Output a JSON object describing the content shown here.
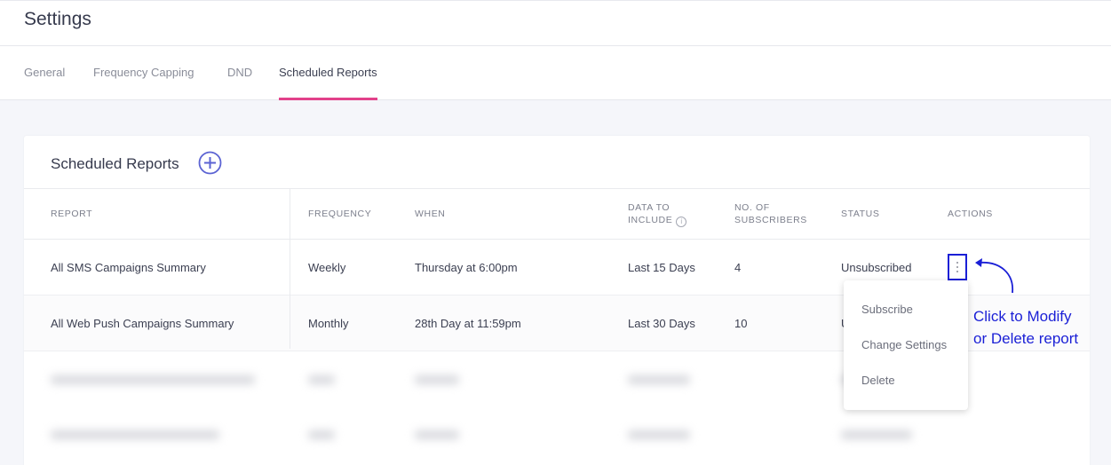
{
  "header": {
    "title": "Settings"
  },
  "tabs": [
    {
      "label": "General",
      "active": false
    },
    {
      "label": "Frequency Capping",
      "active": false
    },
    {
      "label": "DND",
      "active": false
    },
    {
      "label": "Scheduled Reports",
      "active": true
    }
  ],
  "card": {
    "title": "Scheduled Reports",
    "add_icon": "plus-circle-icon",
    "columns": {
      "report": "REPORT",
      "frequency": "FREQUENCY",
      "when": "WHEN",
      "data_line1": "DATA TO",
      "data_line2": "INCLUDE",
      "subs_line1": "NO. OF",
      "subs_line2": "SUBSCRIBERS",
      "status": "STATUS",
      "actions": "ACTIONS"
    },
    "rows": [
      {
        "report": "All SMS Campaigns Summary",
        "frequency": "Weekly",
        "when": "Thursday at 6:00pm",
        "data": "Last 15 Days",
        "subscribers": "4",
        "status": "Unsubscribed"
      },
      {
        "report": "All Web Push Campaigns Summary",
        "frequency": "Monthly",
        "when": "28th Day at 11:59pm",
        "data": "Last 30 Days",
        "subscribers": "10",
        "status": "U"
      }
    ]
  },
  "menu": {
    "items": [
      "Subscribe",
      "Change Settings",
      "Delete"
    ]
  },
  "annotation": {
    "line1": "Click to Modify",
    "line2": "or Delete report"
  },
  "colors": {
    "accent": "#e2418a",
    "annotation": "#1a1fd6",
    "add_icon": "#5b63d3"
  }
}
